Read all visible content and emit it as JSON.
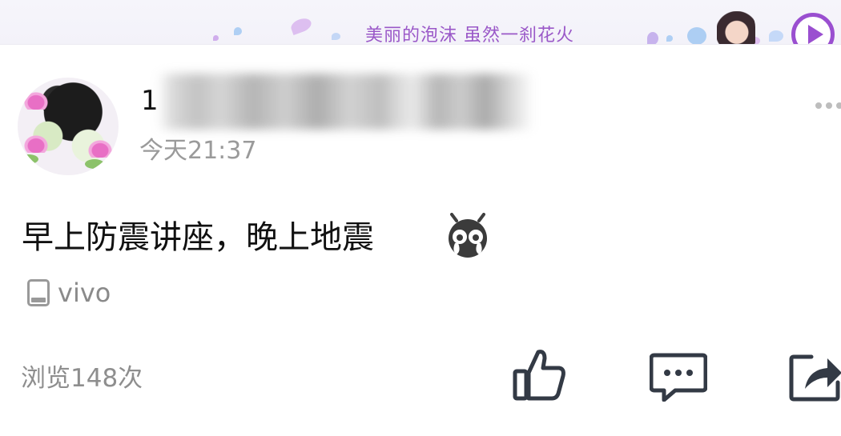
{
  "music_banner": {
    "song_text": "美丽的泡沫 虽然一刹花火",
    "play_icon": "play-circle-icon",
    "accent_color": "#9a4fd0"
  },
  "post": {
    "username_visible": "1",
    "time": "今天21:37",
    "more_icon": "more-dots-icon",
    "text": "早上防震讲座，晚上地震",
    "emoji_icon": "crying-bug-emoji",
    "device_icon": "phone-icon",
    "device": "vivo",
    "views": "浏览148次"
  },
  "actions": {
    "like_icon": "thumbs-up-icon",
    "comment_icon": "comment-icon",
    "share_icon": "share-icon"
  }
}
